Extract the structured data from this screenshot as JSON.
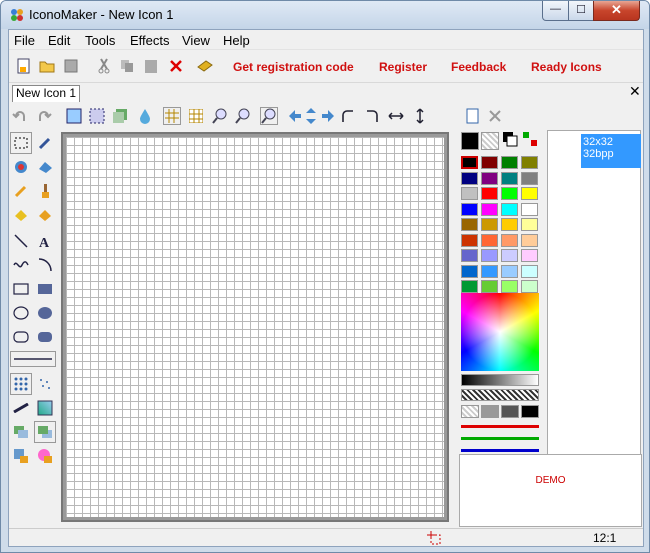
{
  "window": {
    "title": "IconoMaker - New Icon 1",
    "min": "—",
    "max": "☐",
    "close": "✕"
  },
  "menu": [
    "File",
    "Edit",
    "Tools",
    "Effects",
    "View",
    "Help"
  ],
  "links": {
    "get_code": "Get registration code",
    "register": "Register",
    "feedback": "Feedback",
    "ready_icons": "Ready Icons"
  },
  "tab": {
    "label": "New Icon 1",
    "close": "✕"
  },
  "info": {
    "size": "32x32",
    "depth": "32bpp"
  },
  "preview": {
    "demo": "DEMO"
  },
  "status": {
    "zoom": "12:1"
  },
  "colors": {
    "palette": [
      "#800000",
      "#008000",
      "#808000",
      "#000080",
      "#800080",
      "#008080",
      "#808080",
      "#c0c0c0",
      "#ff0000",
      "#00ff00",
      "#ffff00",
      "#0000ff",
      "#ff00ff",
      "#00ffff",
      "#ffffff",
      "#996600",
      "#cc9900",
      "#ffcc00",
      "#ffff99",
      "#cc3300",
      "#ff6633",
      "#ff9966",
      "#ffcc99",
      "#6666cc",
      "#9999ff",
      "#ccccff",
      "#ffccff",
      "#0066cc",
      "#3399ff",
      "#99ccff",
      "#ccffff",
      "#009933",
      "#66cc33",
      "#99ff66",
      "#ccffcc"
    ]
  }
}
